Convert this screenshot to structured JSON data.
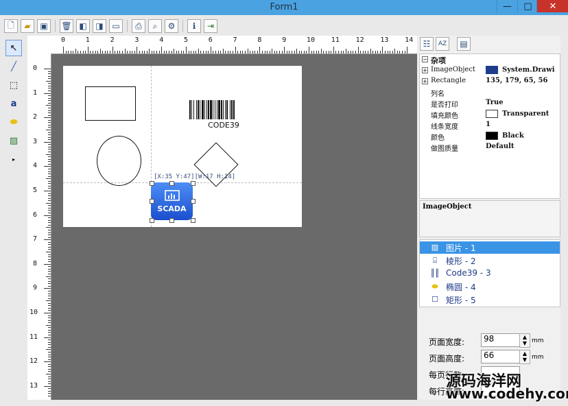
{
  "window": {
    "title": "Form1",
    "minimize": "—",
    "maximize": "□",
    "close": "✕"
  },
  "coords_label": "[X:35 Y:47][W:17 H:14]",
  "barcode_label": "CODE39",
  "scada_label": "SCADA",
  "ruler": {
    "top": [
      "0",
      "1",
      "2",
      "3",
      "4",
      "5",
      "6",
      "7",
      "8",
      "9",
      "10",
      "11",
      "12",
      "13",
      "14"
    ],
    "left": [
      "0",
      "1",
      "2",
      "3",
      "4",
      "5",
      "6",
      "7",
      "8",
      "9",
      "10",
      "11",
      "12",
      "13"
    ]
  },
  "properties": {
    "category": "杂项",
    "rows": [
      {
        "name": "ImageObject",
        "value": "System.Drawi",
        "expand": true
      },
      {
        "name": "Rectangle",
        "value": "135, 179, 65, 56",
        "expand": true
      },
      {
        "name": "列名",
        "value": ""
      },
      {
        "name": "是否打印",
        "value": "True"
      },
      {
        "name": "填充颜色",
        "value": "Transparent"
      },
      {
        "name": "线条宽度",
        "value": "1"
      },
      {
        "name": "颜色",
        "value": "Black"
      },
      {
        "name": "做图质量",
        "value": "Default"
      }
    ]
  },
  "description": {
    "title": "ImageObject"
  },
  "objects": [
    {
      "label": "图片 - 1",
      "icon": "picture-icon",
      "selected": true
    },
    {
      "label": "棱形 - 2",
      "icon": "diamond-icon",
      "selected": false
    },
    {
      "label": "Code39 - 3",
      "icon": "barcode-icon",
      "selected": false
    },
    {
      "label": "椭圆 - 4",
      "icon": "ellipse-icon",
      "selected": false
    },
    {
      "label": "矩形 - 5",
      "icon": "rectangle-icon",
      "selected": false
    }
  ],
  "settings": {
    "page_width": {
      "label": "页面宽度:",
      "value": "98",
      "unit": "mm"
    },
    "page_height": {
      "label": "页面高度:",
      "value": "66",
      "unit": "mm"
    },
    "rows_per_page": {
      "label": "每页行数:",
      "value": "",
      "unit": ""
    },
    "row_height": {
      "label": "每行高度:",
      "value": "",
      "unit": ""
    }
  },
  "watermark": {
    "line1": "源码海洋网",
    "line2": "www.codehy.com"
  }
}
